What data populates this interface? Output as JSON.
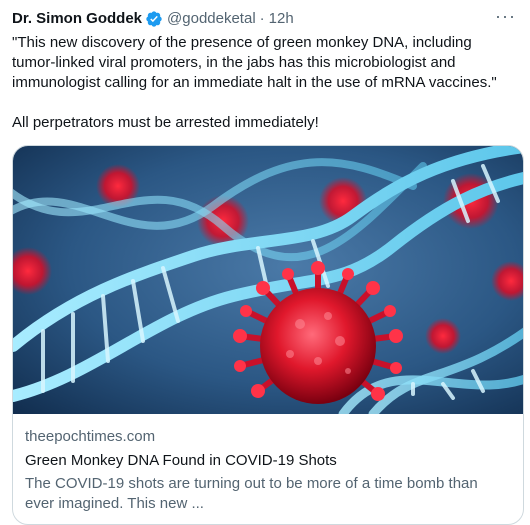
{
  "tweet": {
    "author_name": "Dr. Simon Goddek",
    "handle": "@goddeketal",
    "separator": "·",
    "time": "12h",
    "more_label": "···",
    "text": "\"This new discovery of the presence of green monkey DNA, including tumor-linked viral promoters, in the jabs has this microbiologist and immunologist calling for an immediate halt in the use of mRNA vaccines.\"\n\nAll perpetrators must be arrested immediately!"
  },
  "card": {
    "domain": "theepochtimes.com",
    "title": "Green Monkey DNA Found in COVID-19 Shots",
    "description": "The COVID-19 shots are turning out to be more of a time bomb than ever imagined. This new ..."
  },
  "colors": {
    "verified": "#1d9bf0",
    "secondary_text": "#536471",
    "virus_red": "#e0182c",
    "dna_blue": "#7fd8f2"
  },
  "icons": {
    "verified": "verified-badge-icon",
    "more": "more-options-icon"
  }
}
